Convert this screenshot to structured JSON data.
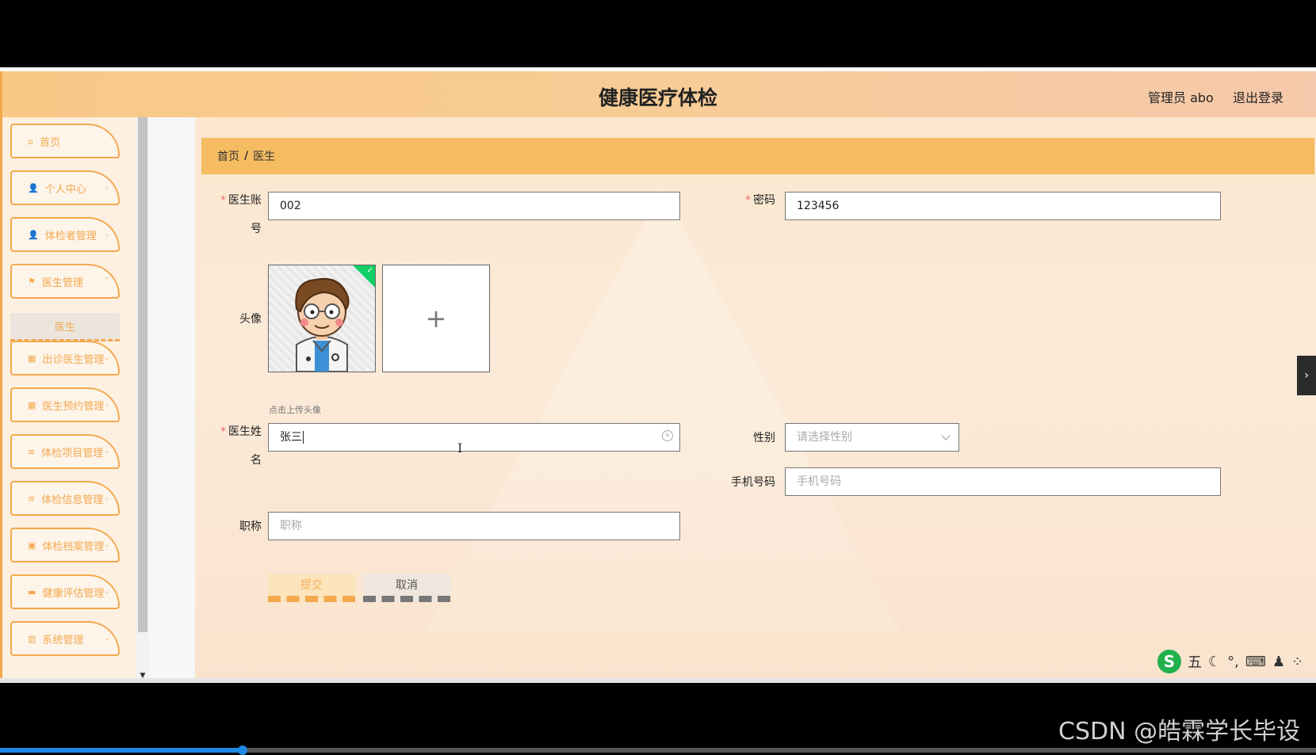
{
  "header": {
    "title": "健康医疗体检",
    "admin": "管理员 abo",
    "logout": "退出登录"
  },
  "sidebar": {
    "items": [
      {
        "label": "首页",
        "icon": "home-icon",
        "glyph": "⌂"
      },
      {
        "label": "个人中心",
        "icon": "user-icon",
        "glyph": "👤"
      },
      {
        "label": "体检者管理",
        "icon": "user-icon",
        "glyph": "👤"
      },
      {
        "label": "医生管理",
        "icon": "flag-icon",
        "glyph": "⚑"
      },
      {
        "label": "出诊医生管理",
        "icon": "grid-icon",
        "glyph": "▦"
      },
      {
        "label": "医生预约管理",
        "icon": "grid-icon",
        "glyph": "▦"
      },
      {
        "label": "体检项目管理",
        "icon": "list-icon",
        "glyph": "≡"
      },
      {
        "label": "体检信息管理",
        "icon": "list-icon",
        "glyph": "≡"
      },
      {
        "label": "体检档案管理",
        "icon": "archive-icon",
        "glyph": "▣"
      },
      {
        "label": "健康评估管理",
        "icon": "chat-icon",
        "glyph": "▬"
      },
      {
        "label": "系统管理",
        "icon": "system-icon",
        "glyph": "▥"
      }
    ],
    "submenu_label": "医生"
  },
  "breadcrumb": {
    "home": "首页",
    "sep": "/",
    "current": "医生"
  },
  "form": {
    "account_label_1": "医生账",
    "account_label_2": "号",
    "account_value": "002",
    "password_label": "密码",
    "password_value": "123456",
    "avatar_label": "头像",
    "upload_plus": "+",
    "upload_hint": "点击上传头像",
    "name_label_1": "医生姓",
    "name_label_2": "名",
    "name_value": "张三",
    "gender_label": "性别",
    "gender_placeholder": "请选择性别",
    "phone_label": "手机号码",
    "phone_placeholder": "手机号码",
    "title_label": "职称",
    "title_placeholder": "职称",
    "required_mark": "*",
    "submit_label": "提交",
    "cancel_label": "取消"
  },
  "ime": {
    "logo": "S",
    "mode": "五",
    "items": [
      "☾",
      "°,",
      "⌨",
      "♟",
      "⁘"
    ]
  },
  "watermark": "CSDN @皓霖学长毕设",
  "colors": {
    "accent": "#f3a94e",
    "breadcrumb_bg": "#f5bc61",
    "required": "#f56c6c"
  }
}
